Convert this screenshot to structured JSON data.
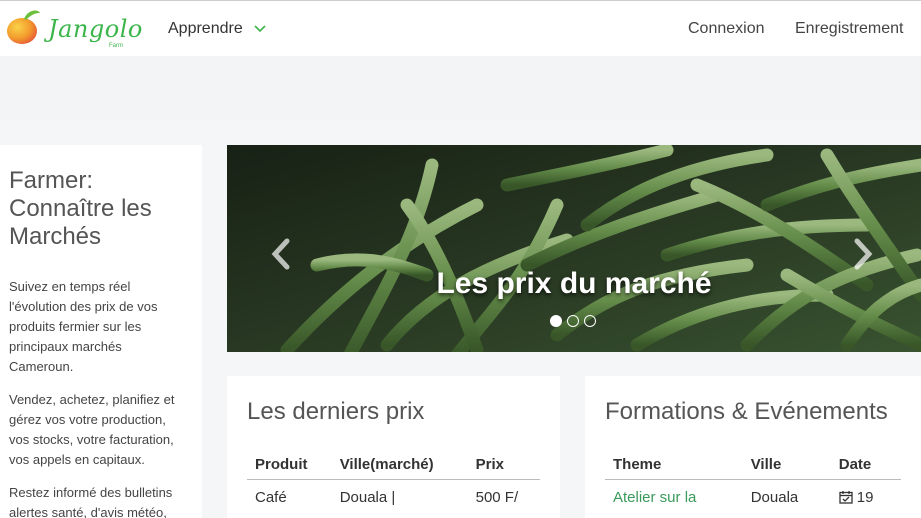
{
  "header": {
    "logo_text": "Jangolo",
    "logo_subtext": "Farm",
    "nav_learn": "Apprendre",
    "login": "Connexion",
    "register": "Enregistrement"
  },
  "sidebar": {
    "title": "Farmer: Connaître les Marchés",
    "paragraphs": [
      "Suivez en temps réel l'évolution des prix de vos produits fermier sur les principaux marchés Cameroun.",
      "Vendez, achetez, planifiez et gérez vos votre production, vos stocks, votre facturation, vos appels en capitaux.",
      "Restez informé des bulletins alertes santé, d'avis météo,"
    ]
  },
  "carousel": {
    "caption": "Les prix du marché",
    "slide_count": 3,
    "active_slide": 1
  },
  "prices": {
    "title": "Les derniers prix",
    "columns": [
      "Produit",
      "Ville(marché)",
      "Prix"
    ],
    "rows": [
      [
        "Café",
        "Douala |",
        "500 F/"
      ]
    ]
  },
  "events": {
    "title": "Formations & Evénements",
    "columns": [
      "Theme",
      "Ville",
      "Date"
    ],
    "rows": [
      [
        "Atelier sur la",
        "Douala",
        "19"
      ]
    ]
  },
  "colors": {
    "brand_green": "#3cb54a",
    "link_green": "#3a9a5a"
  }
}
